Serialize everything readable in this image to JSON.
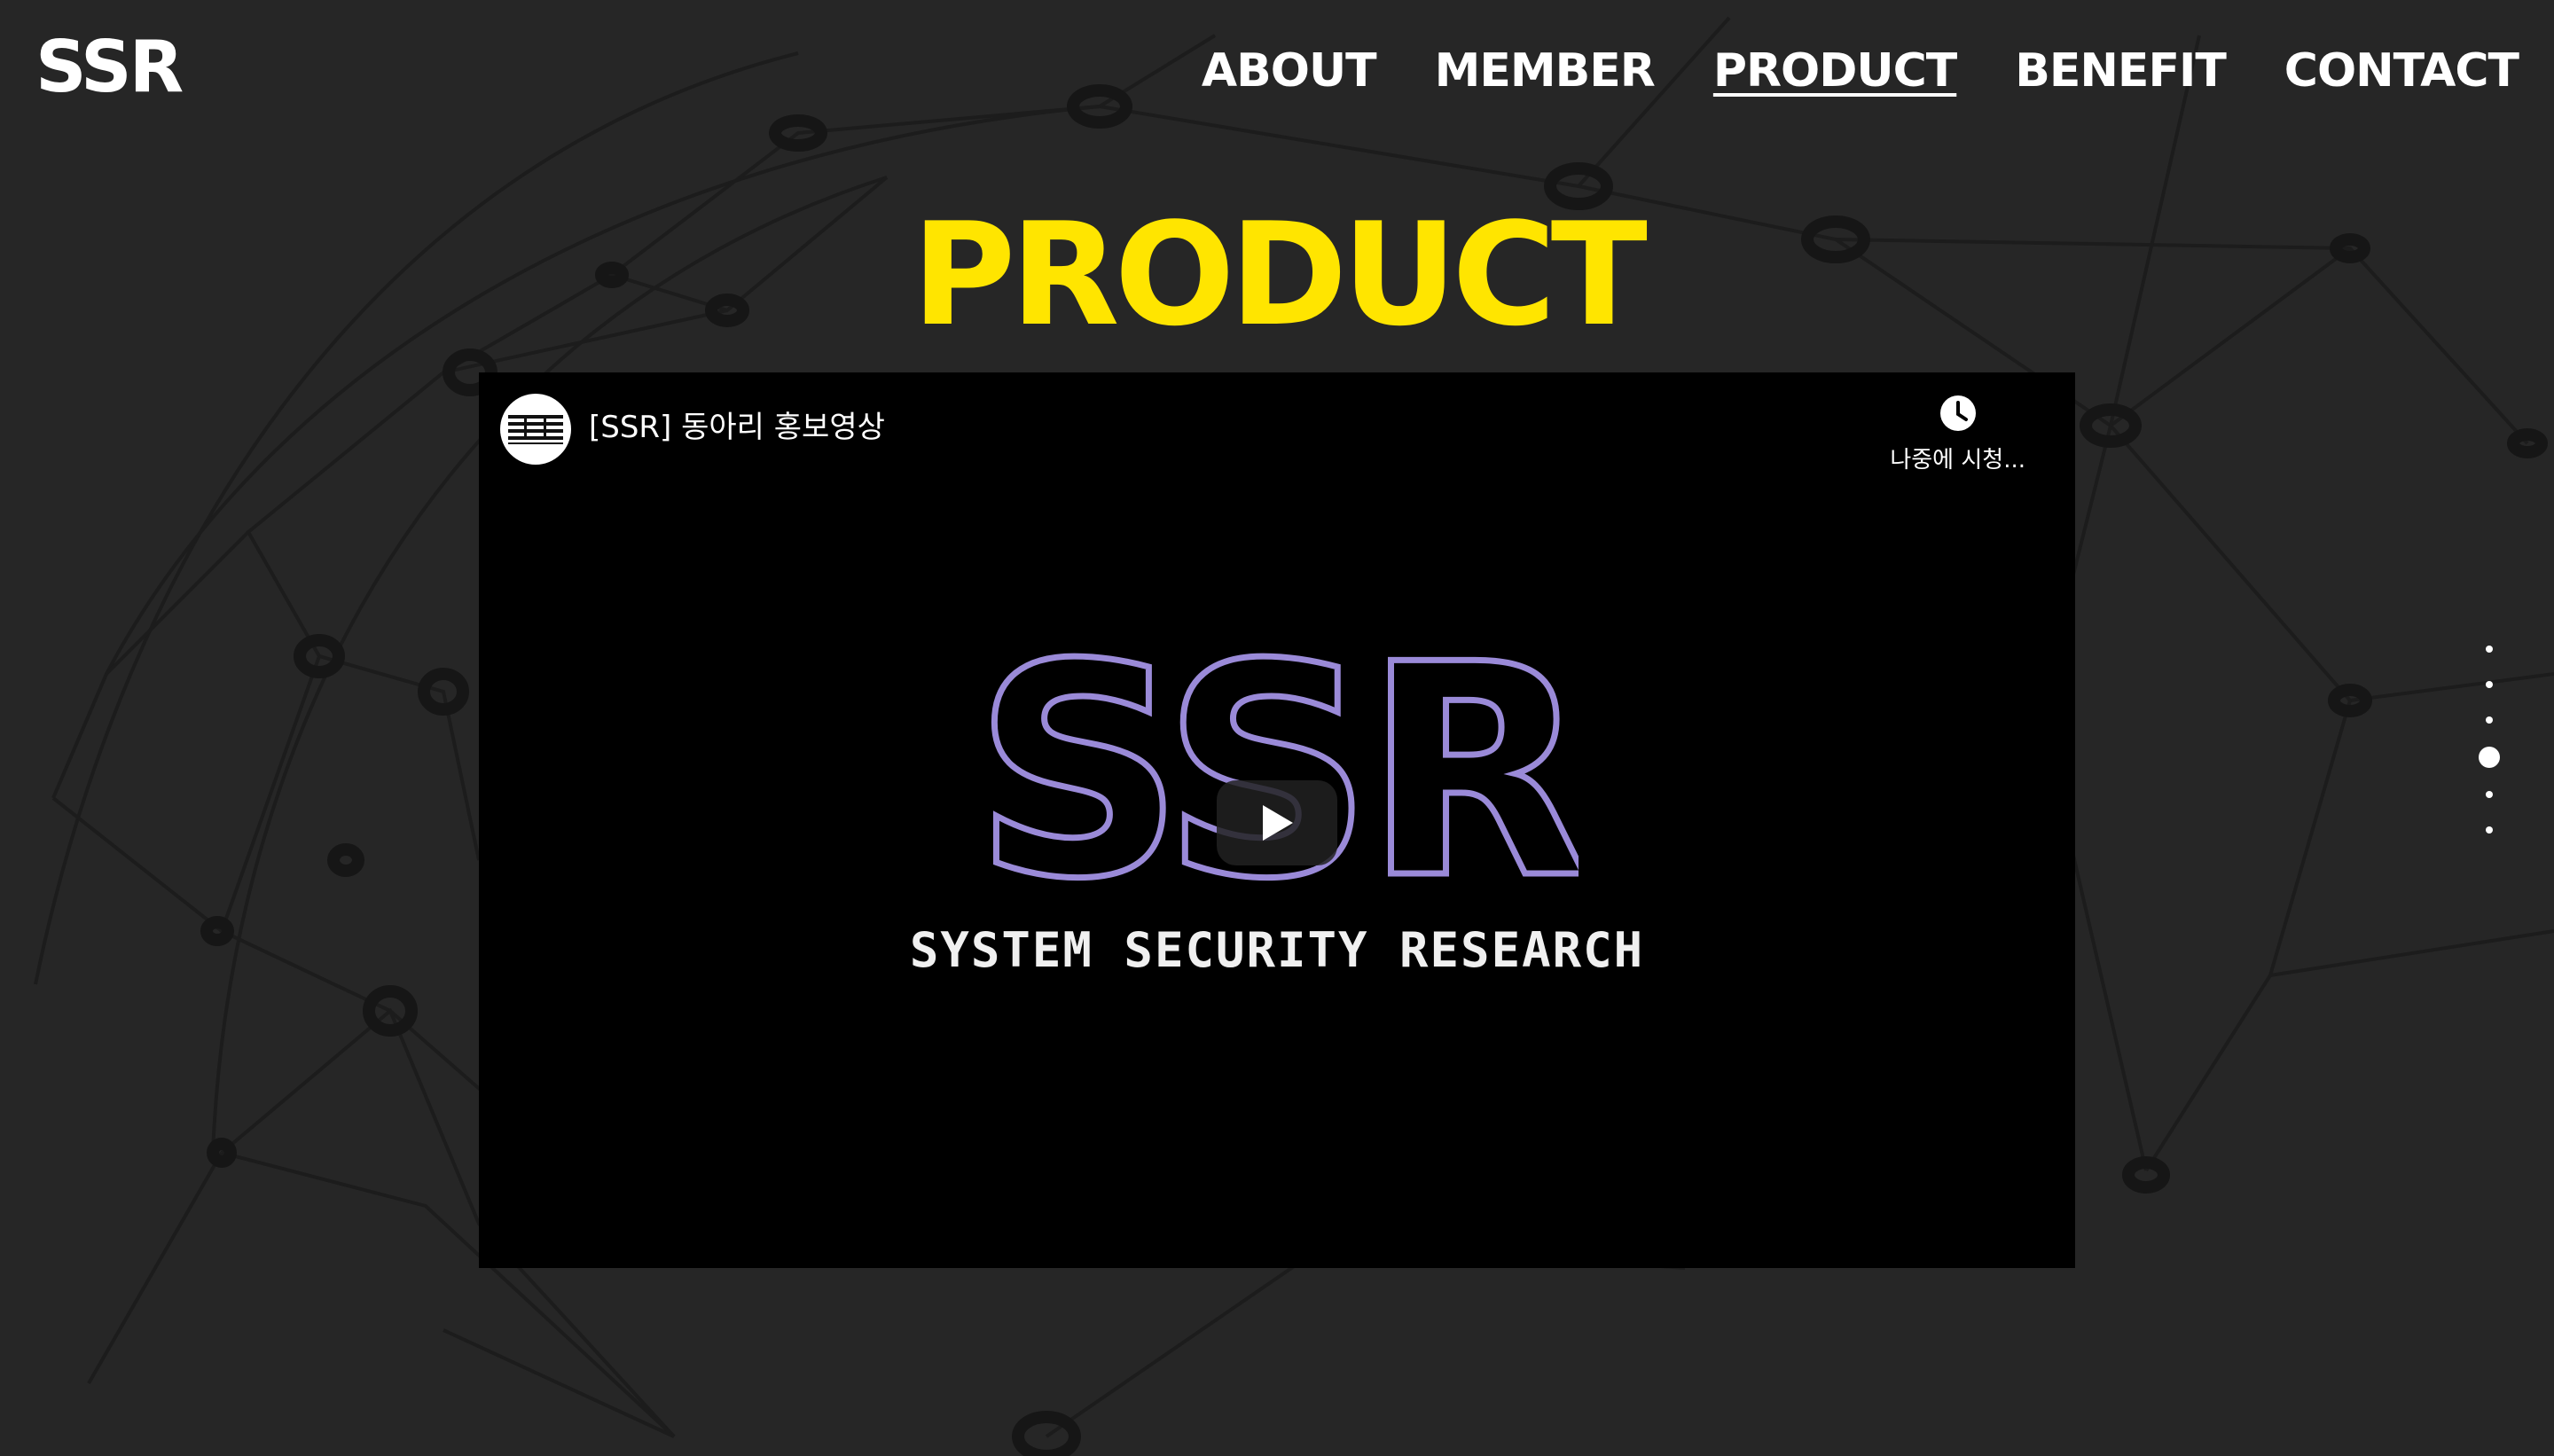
{
  "header": {
    "logo": "SSR",
    "nav": [
      {
        "label": "ABOUT"
      },
      {
        "label": "MEMBER"
      },
      {
        "label": "PRODUCT",
        "active": true
      },
      {
        "label": "BENEFIT"
      },
      {
        "label": "CONTACT"
      }
    ]
  },
  "section": {
    "title": "PRODUCT"
  },
  "video": {
    "title": "[SSR] 동아리 홍보영상",
    "watch_later_label": "나중에 시청...",
    "thumbnail_logo": "SSR",
    "thumbnail_subtitle": "SYSTEM SECURITY RESEARCH"
  },
  "side_nav": {
    "dot_count": 6,
    "active_index": 3
  },
  "colors": {
    "background": "#262626",
    "accent": "#ffe500",
    "video_bg": "#000000",
    "logo_outline": "#9a8ad8"
  }
}
